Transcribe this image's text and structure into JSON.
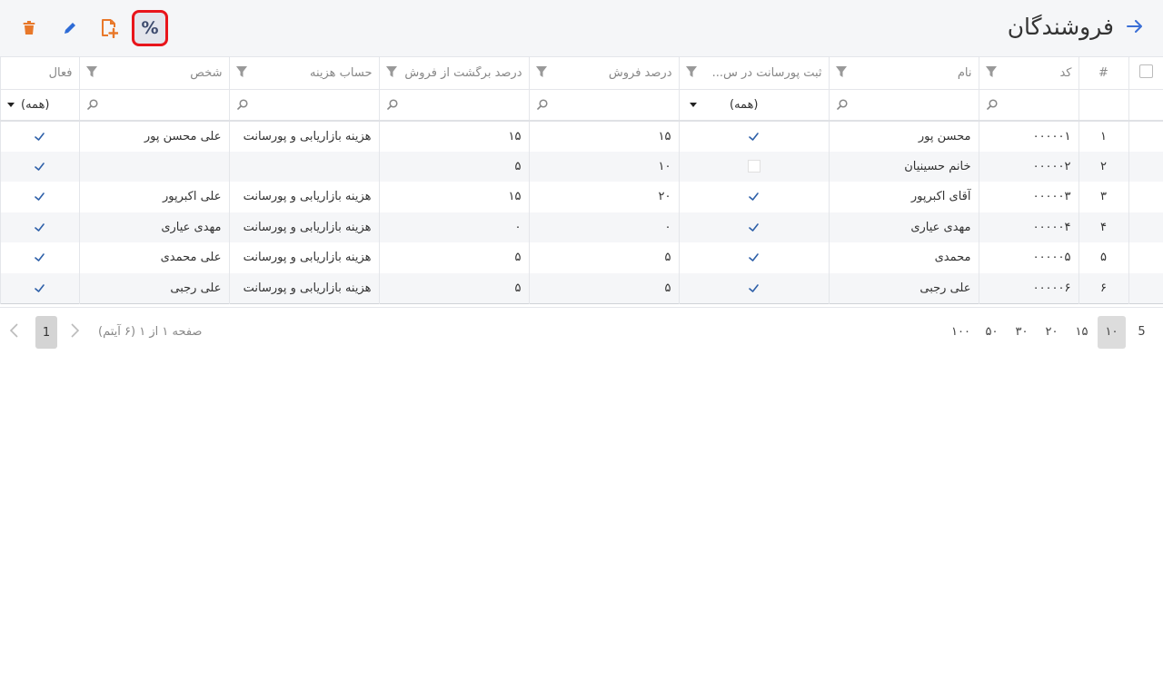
{
  "header": {
    "title": "فروشندگان",
    "back_icon": "arrow-right-icon",
    "toolbar": {
      "percent_label": "%",
      "new_doc_icon": "file-plus-icon",
      "edit_icon": "pencil-icon",
      "delete_icon": "trash-icon"
    },
    "colors": {
      "accent": "#3b6fd6",
      "highlight_border": "#e8141b",
      "orange": "#e8782a"
    }
  },
  "table": {
    "columns": [
      {
        "key": "select",
        "label": ""
      },
      {
        "key": "row",
        "label": "#"
      },
      {
        "key": "code",
        "label": "کد"
      },
      {
        "key": "name",
        "label": "نام"
      },
      {
        "key": "register",
        "label": "ثبت پورسانت در س..."
      },
      {
        "key": "sale_pct",
        "label": "درصد فروش"
      },
      {
        "key": "return_pct",
        "label": "درصد برگشت از فروش"
      },
      {
        "key": "expense",
        "label": "حساب هزینه"
      },
      {
        "key": "person",
        "label": "شخص"
      },
      {
        "key": "active",
        "label": "فعال"
      }
    ],
    "filters": {
      "register_select": "(همه)",
      "active_select": "(همه)"
    },
    "rows": [
      {
        "row": "۱",
        "code": "۰۰۰۰۰۱",
        "name": "محسن پور",
        "register": true,
        "sale_pct": "۱۵",
        "return_pct": "۱۵",
        "expense": "هزینه بازاریابی و پورسانت",
        "person": "علی محسن پور",
        "active": true
      },
      {
        "row": "۲",
        "code": "۰۰۰۰۰۲",
        "name": "خانم حسینیان",
        "register": false,
        "sale_pct": "۱۰",
        "return_pct": "۵",
        "expense": "",
        "person": "",
        "active": true
      },
      {
        "row": "۳",
        "code": "۰۰۰۰۰۳",
        "name": "آقای اکبرپور",
        "register": true,
        "sale_pct": "۲۰",
        "return_pct": "۱۵",
        "expense": "هزینه بازاریابی و پورسانت",
        "person": "علی اکبرپور",
        "active": true
      },
      {
        "row": "۴",
        "code": "۰۰۰۰۰۴",
        "name": "مهدی عیاری",
        "register": true,
        "sale_pct": "۰",
        "return_pct": "۰",
        "expense": "هزینه بازاریابی و پورسانت",
        "person": "مهدی عیاری",
        "active": true
      },
      {
        "row": "۵",
        "code": "۰۰۰۰۰۵",
        "name": "محمدی",
        "register": true,
        "sale_pct": "۵",
        "return_pct": "۵",
        "expense": "هزینه بازاریابی و پورسانت",
        "person": "علی محمدی",
        "active": true
      },
      {
        "row": "۶",
        "code": "۰۰۰۰۰۶",
        "name": "علی رجبی",
        "register": true,
        "sale_pct": "۵",
        "return_pct": "۵",
        "expense": "هزینه بازاریابی و پورسانت",
        "person": "علی رجبی",
        "active": true
      }
    ]
  },
  "pager": {
    "page_sizes": [
      "5",
      "۱۰",
      "۱۵",
      "۲۰",
      "۳۰",
      "۵۰",
      "۱۰۰"
    ],
    "active_size": "۱۰",
    "info": "صفحه ۱ از ۱ (۶ آیتم)",
    "current_page": "1"
  }
}
